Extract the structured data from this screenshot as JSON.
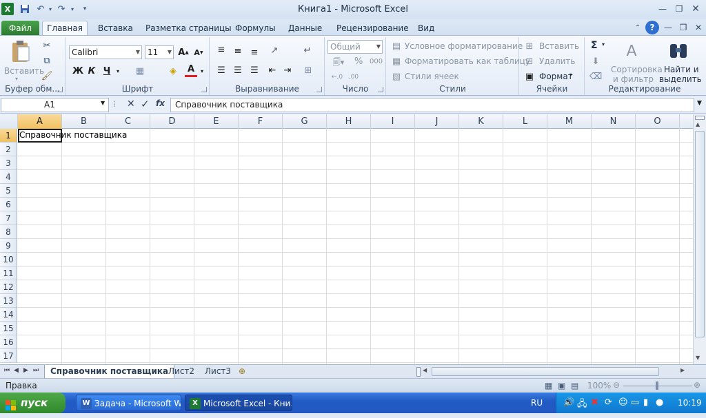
{
  "window": {
    "title": "Книга1  -  Microsoft Excel",
    "app_icon": "excel-icon",
    "quick_access": [
      "save-icon",
      "undo-icon",
      "redo-icon",
      "customize-icon"
    ]
  },
  "ribbon_tabs": [
    "Файл",
    "Главная",
    "Вставка",
    "Разметка страницы",
    "Формулы",
    "Данные",
    "Рецензирование",
    "Вид"
  ],
  "active_tab": "Главная",
  "groups": {
    "clipboard": {
      "label": "Буфер обм...",
      "paste": "Вставить"
    },
    "font": {
      "label": "Шрифт",
      "font_name": "Calibri",
      "font_size": "11",
      "bold": "Ж",
      "italic": "К",
      "underline": "Ч"
    },
    "alignment": {
      "label": "Выравнивание"
    },
    "number": {
      "label": "Число",
      "format": "Общий",
      "percent": "%",
      "thousands": "000"
    },
    "styles": {
      "label": "Стили",
      "conditional": "Условное форматирование",
      "as_table": "Форматировать как таблицу",
      "cell_styles": "Стили ячеек"
    },
    "cells": {
      "label": "Ячейки",
      "insert": "Вставить",
      "delete": "Удалить",
      "format": "Формат"
    },
    "editing": {
      "label": "Редактирование",
      "sort_line1": "Сортировка",
      "sort_line2": "и фильтр",
      "find_line1": "Найти и",
      "find_line2": "выделить",
      "sum": "Σ"
    }
  },
  "formula_bar": {
    "name_box": "A1",
    "fx": "fx",
    "content": "Справочник поставщика"
  },
  "columns": [
    "A",
    "B",
    "C",
    "D",
    "E",
    "F",
    "G",
    "H",
    "I",
    "J",
    "K",
    "L",
    "M",
    "N",
    "O"
  ],
  "rows": [
    "1",
    "2",
    "3",
    "4",
    "5",
    "6",
    "7",
    "8",
    "9",
    "10",
    "11",
    "12",
    "13",
    "14",
    "15",
    "16",
    "17"
  ],
  "selected_cell": "A1",
  "cells": {
    "A1": "Справочник поставщика"
  },
  "sheets": [
    "Справочник поставщика",
    "Лист2",
    "Лист3"
  ],
  "active_sheet": "Справочник поставщика",
  "status": {
    "mode": "Правка",
    "zoom": "100%"
  },
  "taskbar": {
    "start": "пуск",
    "tasks": [
      {
        "label": "Задача - Microsoft W...",
        "icon": "word-icon"
      },
      {
        "label": "Microsoft Excel - Кни...",
        "icon": "excel-icon"
      }
    ],
    "lang": "RU",
    "time": "10:19"
  }
}
